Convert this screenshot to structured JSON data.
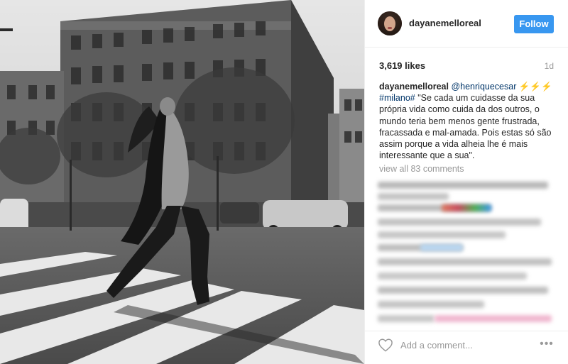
{
  "post": {
    "username": "dayanemelloreal",
    "follow_label": "Follow",
    "likes": "3,619 likes",
    "age": "1d"
  },
  "caption": {
    "username": "dayanemelloreal",
    "mention": "@henriquecesar",
    "bolts": "⚡⚡⚡",
    "hashtag": "#milano#",
    "text": " \"Se cada um cuidasse da sua própria vida como cuida da dos outros, o mundo teria bem menos gente frustrada, fracassada e mal-amada. Pois estas só são assim porque a vida alheia lhe é mais interessante que a sua\"."
  },
  "comments": {
    "view_all": "view all 83 comments"
  },
  "footer": {
    "input_placeholder": "Add a comment...",
    "more_label": "•••"
  },
  "icons": {
    "avatar": "avatar",
    "heart": "heart-icon",
    "more": "more-options-icon"
  },
  "colors": {
    "accent": "#3897f0",
    "link": "#003569",
    "muted": "#999999"
  }
}
